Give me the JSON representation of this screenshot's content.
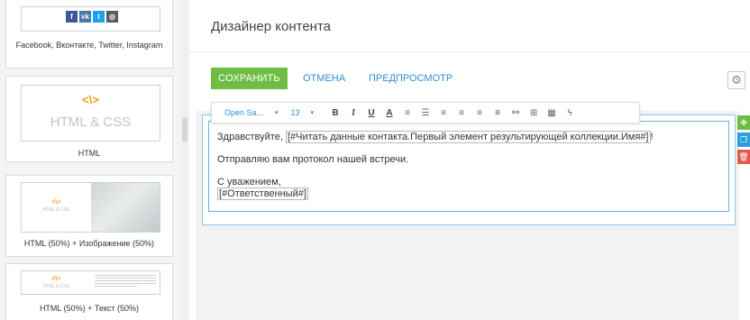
{
  "sidebar": {
    "blocks": [
      {
        "id": "social",
        "caption": "Facebook, Вконтакте, Twitter, Instagram",
        "icons": [
          {
            "name": "facebook-icon",
            "glyph": "f",
            "color": "#3b5998"
          },
          {
            "name": "vkontakte-icon",
            "glyph": "vk",
            "color": "#4a76a8"
          },
          {
            "name": "twitter-icon",
            "glyph": "t",
            "color": "#1da1f2"
          },
          {
            "name": "instagram-icon",
            "glyph": "◎",
            "color": "#5a5a5a"
          }
        ]
      },
      {
        "id": "html",
        "thumb_icon": "<\\>",
        "thumb_label": "HTML & CSS",
        "caption": "HTML"
      },
      {
        "id": "html-image",
        "thumb_icon": "<\\>",
        "thumb_label": "HTML & CSS",
        "caption": "HTML (50%) + Изображение (50%)"
      },
      {
        "id": "html-text",
        "thumb_icon": "<\\>",
        "thumb_label": "HTML & CSS",
        "caption": "HTML (50%) + Текст (50%)"
      }
    ]
  },
  "header": {
    "title": "Дизайнер контента"
  },
  "actions": {
    "save": "СОХРАНИТЬ",
    "cancel": "ОТМЕНА",
    "preview": "ПРЕДПРОСМОТР",
    "settings_icon": "gear-icon"
  },
  "toolbar": {
    "font": "Open Sa...",
    "font_caret": "▾",
    "size": "13",
    "size_caret": "▾",
    "bold": "B",
    "italic": "I",
    "underline": "U",
    "text_color": "A",
    "ordered_list": "≡",
    "unordered_list": "☰",
    "align_left": "≡",
    "align_center": "≡",
    "align_right": "≡",
    "align_justify": "≡",
    "link": "⚯",
    "macro": "⊞",
    "table": "▦",
    "flash": "ϟ"
  },
  "editor": {
    "greeting": "Здравствуйте,",
    "greeting_macro": "[#Читать данные контакта.Первый элемент результирующей коллекции.Имя#]",
    "greeting_tail": "!",
    "body": "Отправляю вам протокол нашей встречи.",
    "regards": "С уважением,",
    "signature_macro": "[#Ответственный#]"
  },
  "colors": {
    "accent_green": "#6fbe44",
    "link_blue": "#2d8fd6",
    "frame_blue": "#6aaee0",
    "delete_red": "#e6584b"
  }
}
